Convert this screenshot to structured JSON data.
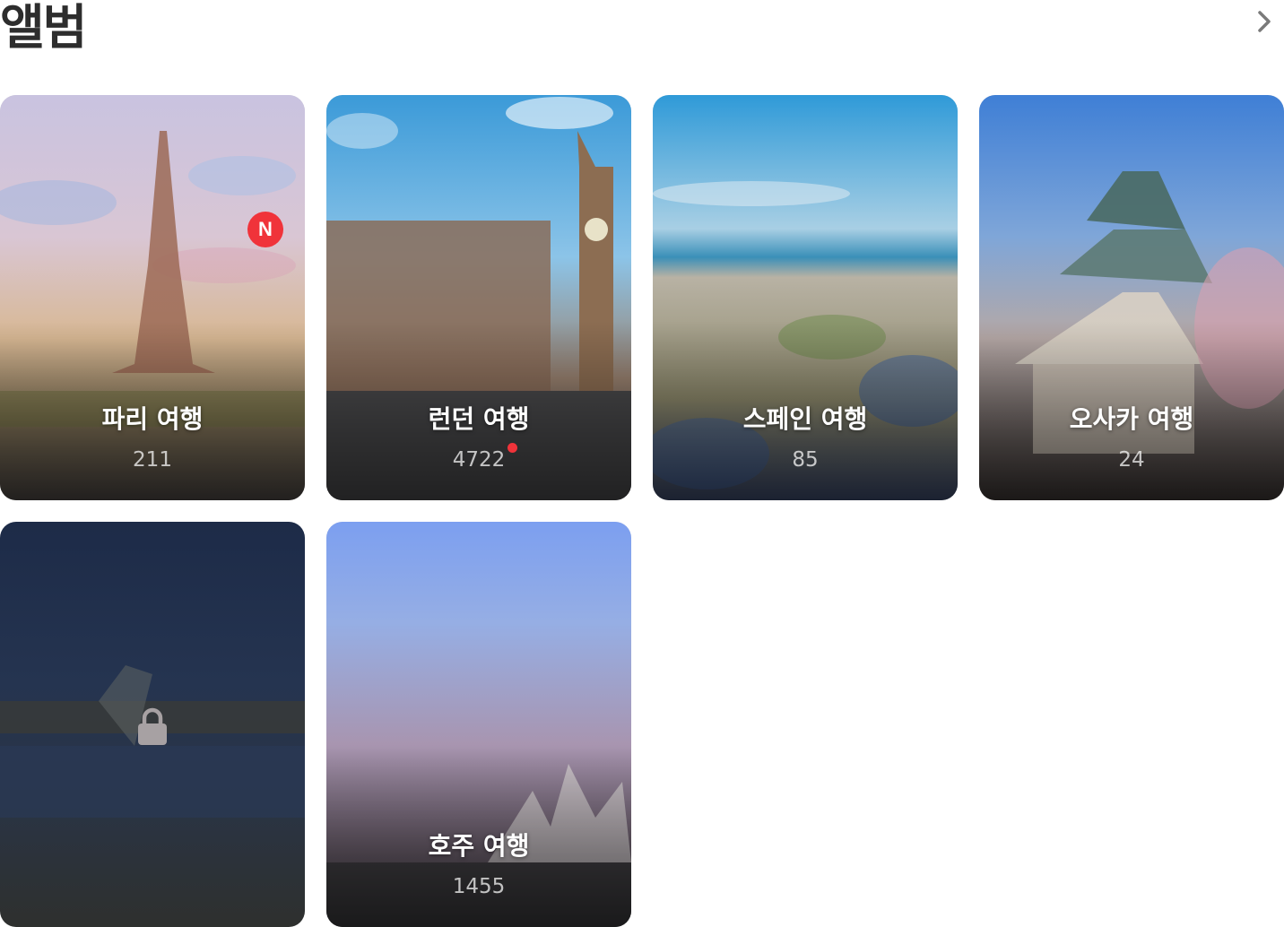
{
  "header": {
    "title": "앨범",
    "more_icon": "chevron-right-icon"
  },
  "albums": [
    {
      "name": "파리 여행",
      "count": "211",
      "badge": "N",
      "theme": "paris"
    },
    {
      "name": "런던 여행",
      "count": "4722",
      "unread_dot": true,
      "theme": "london"
    },
    {
      "name": "스페인 여행",
      "count": "85",
      "theme": "spain"
    },
    {
      "name": "오사카 여행",
      "count": "24",
      "theme": "osaka"
    },
    {
      "name": "",
      "count": "",
      "locked": true,
      "lock_icon": "lock-icon",
      "theme": "night-bridge"
    },
    {
      "name": "호주 여행",
      "count": "1455",
      "theme": "sydney"
    }
  ],
  "colors": {
    "badge_red": "#f0333a",
    "title_text": "#2d2d2d",
    "chevron": "#7a7a7a"
  }
}
